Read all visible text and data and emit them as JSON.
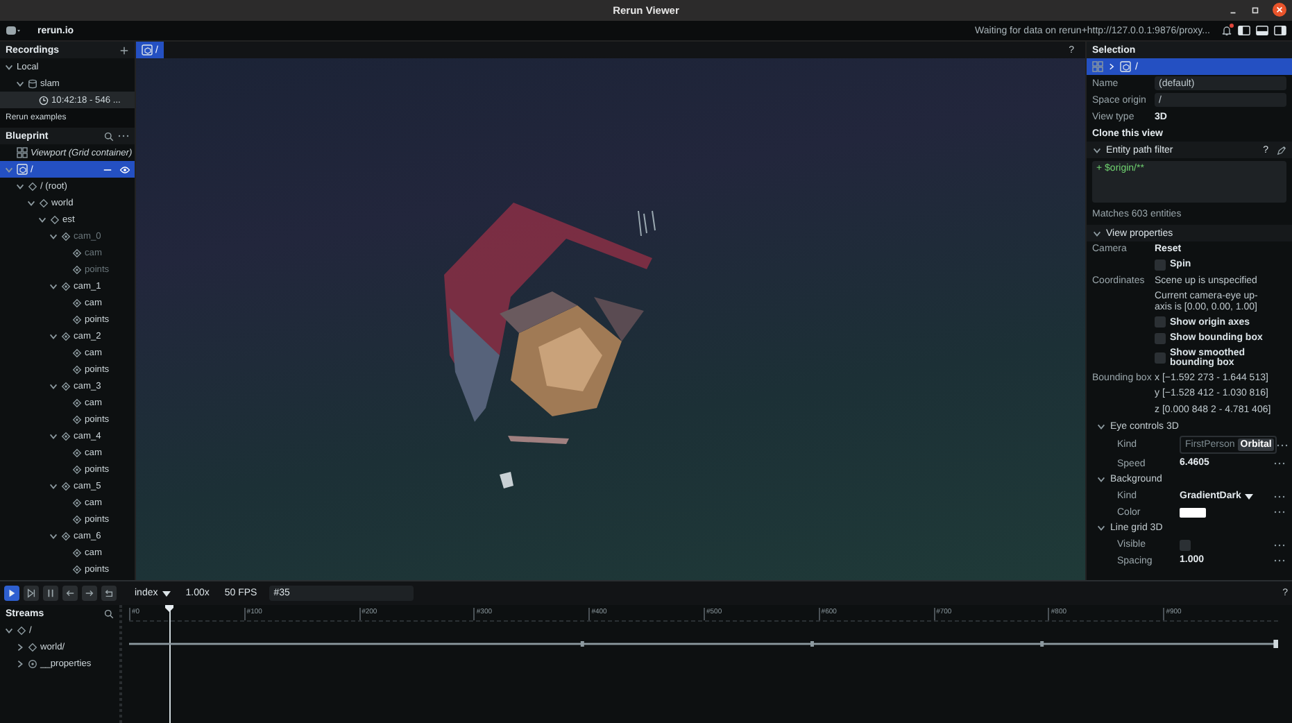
{
  "window": {
    "title": "Rerun Viewer"
  },
  "top_bar": {
    "brand": "rerun.io",
    "status": "Waiting for data on rerun+http://127.0.0.1:9876/proxy...",
    "unread_notifications": true
  },
  "recordings": {
    "title": "Recordings",
    "items": [
      {
        "label": "Local",
        "expanded": true,
        "children": [
          {
            "label": "slam",
            "kind": "recording",
            "expanded": true,
            "children": [
              {
                "label": "10:42:18 - 546 ...",
                "kind": "time",
                "selected": true
              }
            ]
          }
        ]
      }
    ],
    "examples": "Rerun examples"
  },
  "blueprint": {
    "title": "Blueprint",
    "items": [
      {
        "label": "Viewport (Grid container)",
        "kind": "container",
        "selected": false
      },
      {
        "label": "/",
        "kind": "view",
        "expanded": true,
        "selected": true,
        "visible": true,
        "children": [
          {
            "label": "/ (root)",
            "kind": "group",
            "expanded": true,
            "selected": false,
            "visible": true,
            "children": [
              {
                "label": "world",
                "kind": "group",
                "expanded": true,
                "selected": false,
                "visible": true,
                "children": [
                  {
                    "label": "est",
                    "kind": "group",
                    "expanded": true,
                    "selected": false,
                    "visible": true,
                    "children": [
                      {
                        "label": "cam_0",
                        "kind": "entity",
                        "expanded": true,
                        "selected": false,
                        "visible": false,
                        "children": [
                          {
                            "label": "cam",
                            "kind": "entity",
                            "selected": false,
                            "visible": false
                          },
                          {
                            "label": "points",
                            "kind": "entity",
                            "selected": false,
                            "visible": false
                          }
                        ]
                      },
                      {
                        "label": "cam_1",
                        "kind": "entity",
                        "expanded": true,
                        "selected": false,
                        "visible": true,
                        "children": [
                          {
                            "label": "cam",
                            "kind": "entity",
                            "selected": false,
                            "visible": true
                          },
                          {
                            "label": "points",
                            "kind": "entity",
                            "selected": false,
                            "visible": true
                          }
                        ]
                      },
                      {
                        "label": "cam_2",
                        "kind": "entity",
                        "expanded": true,
                        "selected": false,
                        "visible": true,
                        "children": [
                          {
                            "label": "cam",
                            "kind": "entity",
                            "selected": false,
                            "visible": true
                          },
                          {
                            "label": "points",
                            "kind": "entity",
                            "selected": false,
                            "visible": true
                          }
                        ]
                      },
                      {
                        "label": "cam_3",
                        "kind": "entity",
                        "expanded": true,
                        "selected": false,
                        "visible": true,
                        "children": [
                          {
                            "label": "cam",
                            "kind": "entity",
                            "selected": false,
                            "visible": true
                          },
                          {
                            "label": "points",
                            "kind": "entity",
                            "selected": false,
                            "visible": true
                          }
                        ]
                      },
                      {
                        "label": "cam_4",
                        "kind": "entity",
                        "expanded": true,
                        "selected": false,
                        "visible": true,
                        "children": [
                          {
                            "label": "cam",
                            "kind": "entity",
                            "selected": false,
                            "visible": true
                          },
                          {
                            "label": "points",
                            "kind": "entity",
                            "selected": false,
                            "visible": true
                          }
                        ]
                      },
                      {
                        "label": "cam_5",
                        "kind": "entity",
                        "expanded": true,
                        "selected": false,
                        "visible": true,
                        "children": [
                          {
                            "label": "cam",
                            "kind": "entity",
                            "selected": false,
                            "visible": true
                          },
                          {
                            "label": "points",
                            "kind": "entity",
                            "selected": false,
                            "visible": true
                          }
                        ]
                      },
                      {
                        "label": "cam_6",
                        "kind": "entity",
                        "expanded": true,
                        "selected": false,
                        "visible": true,
                        "children": [
                          {
                            "label": "cam",
                            "kind": "entity",
                            "selected": false,
                            "visible": true
                          },
                          {
                            "label": "points",
                            "kind": "entity",
                            "selected": false,
                            "visible": true
                          }
                        ]
                      }
                    ]
                  }
                ]
              }
            ]
          }
        ]
      }
    ]
  },
  "viewport": {
    "tab": "/",
    "help": "?"
  },
  "selection": {
    "title": "Selection",
    "breadcrumb": "/",
    "fields": [
      {
        "label": "Name",
        "kind": "input",
        "value": "(default)"
      },
      {
        "label": "Space origin",
        "kind": "input",
        "value": "/"
      },
      {
        "label": "View type",
        "kind": "text",
        "value": "3D"
      }
    ],
    "clone_button": "Clone this view",
    "sections": [
      {
        "kind": "filter",
        "title": "Entity path filter",
        "help": "?",
        "expanded": true,
        "expression": "+ $origin/**",
        "matches": "Matches 603 entities"
      },
      {
        "kind": "properties",
        "title": "View properties",
        "expanded": true,
        "rows": [
          {
            "kind": "button",
            "label": "Camera",
            "value": "Reset"
          },
          {
            "kind": "checkbox",
            "text": "Spin",
            "checked": false
          },
          {
            "kind": "text",
            "label": "Coordinates",
            "value": "Scene up is unspecified"
          },
          {
            "kind": "text",
            "value": "Current camera-eye up-axis is [0.00, 0.00, 1.00]"
          },
          {
            "kind": "checkbox",
            "text": "Show origin axes",
            "checked": false
          },
          {
            "kind": "checkbox",
            "text": "Show bounding box",
            "checked": false
          },
          {
            "kind": "checkbox",
            "text": "Show smoothed bounding box",
            "checked": false
          },
          {
            "kind": "text",
            "label": "Bounding box",
            "value": "x [−1.592 273 - 1.644 513]"
          },
          {
            "kind": "text",
            "value": "y [−1.528 412 - 1.030 816]"
          },
          {
            "kind": "text",
            "value": "z [0.000 848 2 - 4.781 406]"
          },
          {
            "kind": "subsection",
            "title": "Eye controls 3D",
            "expanded": true,
            "rows": [
              {
                "kind": "segmented",
                "label": "Kind",
                "options": [
                  {
                    "label": "FirstPerson",
                    "selected": false
                  },
                  {
                    "label": "Orbital",
                    "selected": true
                  }
                ]
              },
              {
                "kind": "number",
                "label": "Speed",
                "value": "6.4605"
              }
            ]
          },
          {
            "kind": "subsection",
            "title": "Background",
            "expanded": true,
            "rows": [
              {
                "kind": "dropdown",
                "label": "Kind",
                "value": "GradientDark"
              },
              {
                "kind": "color",
                "label": "Color",
                "color": "#ffffff"
              }
            ]
          },
          {
            "kind": "subsection",
            "title": "Line grid 3D",
            "expanded": true,
            "rows": [
              {
                "kind": "checkbox",
                "label": "Visible",
                "checked": false
              },
              {
                "kind": "number",
                "label": "Spacing",
                "value": "1.000"
              }
            ]
          }
        ]
      }
    ]
  },
  "timeline": {
    "controls": [
      {
        "kind": "play",
        "selected": true
      },
      {
        "kind": "follow",
        "selected": false
      },
      {
        "kind": "pause",
        "selected": false
      },
      {
        "kind": "step_back",
        "selected": false
      },
      {
        "kind": "step_forward",
        "selected": false
      },
      {
        "kind": "loop",
        "selected": false
      }
    ],
    "timeline_name": "index",
    "speed": "1.00x",
    "fps": "50 FPS",
    "frame": "#35",
    "help": "?",
    "ticks": [
      "#0",
      "#100",
      "#200",
      "#300",
      "#400",
      "#500",
      "#600",
      "#700",
      "#800",
      "#900"
    ],
    "playhead": {
      "level": 0.035
    }
  },
  "streams": {
    "title": "Streams",
    "items": [
      {
        "label": "/",
        "kind": "group",
        "expanded": true,
        "children": [
          {
            "label": "world/",
            "kind": "group",
            "expanded": false
          },
          {
            "label": "__properties",
            "kind": "properties",
            "expanded": false
          }
        ]
      }
    ]
  }
}
